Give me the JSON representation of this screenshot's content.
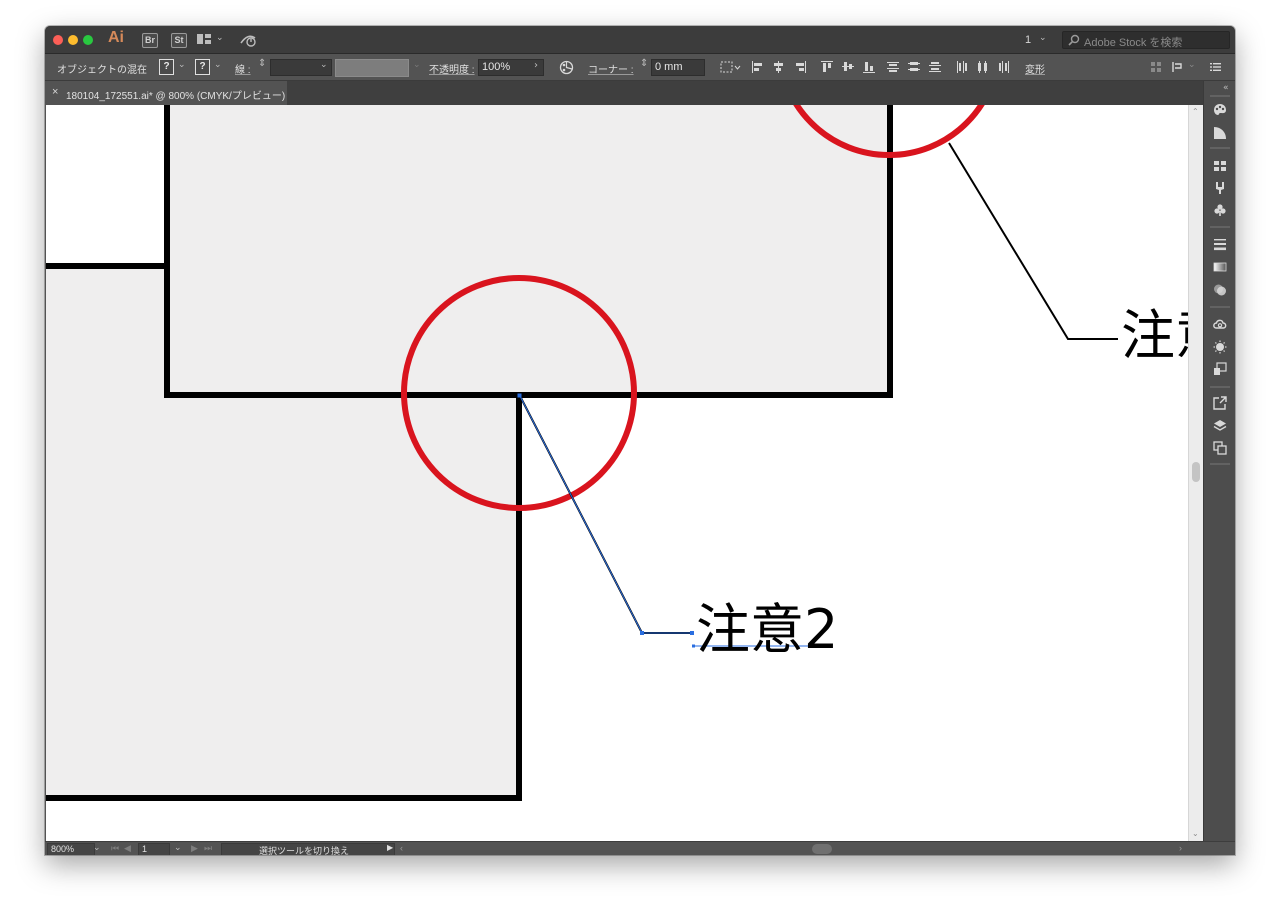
{
  "titlebar": {
    "app_logo": "Ai",
    "bridge_label": "Br",
    "stock_label": "St",
    "page_number": "1",
    "search_placeholder": "Adobe Stock を検索",
    "icons": [
      "workspace-switcher-icon",
      "gpu-performance-icon",
      "magnifier-icon"
    ]
  },
  "control_bar": {
    "selection_label": "オブジェクトの混在",
    "fill_value": "?",
    "stroke_value": "?",
    "stroke_label": "線 :",
    "opacity_label": "不透明度 :",
    "opacity_value": "100%",
    "corner_label": "コーナー :",
    "corner_value": "0 mm",
    "transform_label": "変形"
  },
  "document_tab": {
    "close": "×",
    "title": "180104_172551.ai* @ 800% (CMYK/プレビュー)"
  },
  "artwork": {
    "callout_1": "注意2",
    "callout_2_visible": "注意",
    "colors": {
      "shape_fill": "#efeeee",
      "outline": "#000000",
      "circle": "#d9141e",
      "selection": "#2a6ee0"
    }
  },
  "status_bar": {
    "zoom": "800%",
    "artboard": "1",
    "tool_info": "選択ツールを切り換え"
  }
}
